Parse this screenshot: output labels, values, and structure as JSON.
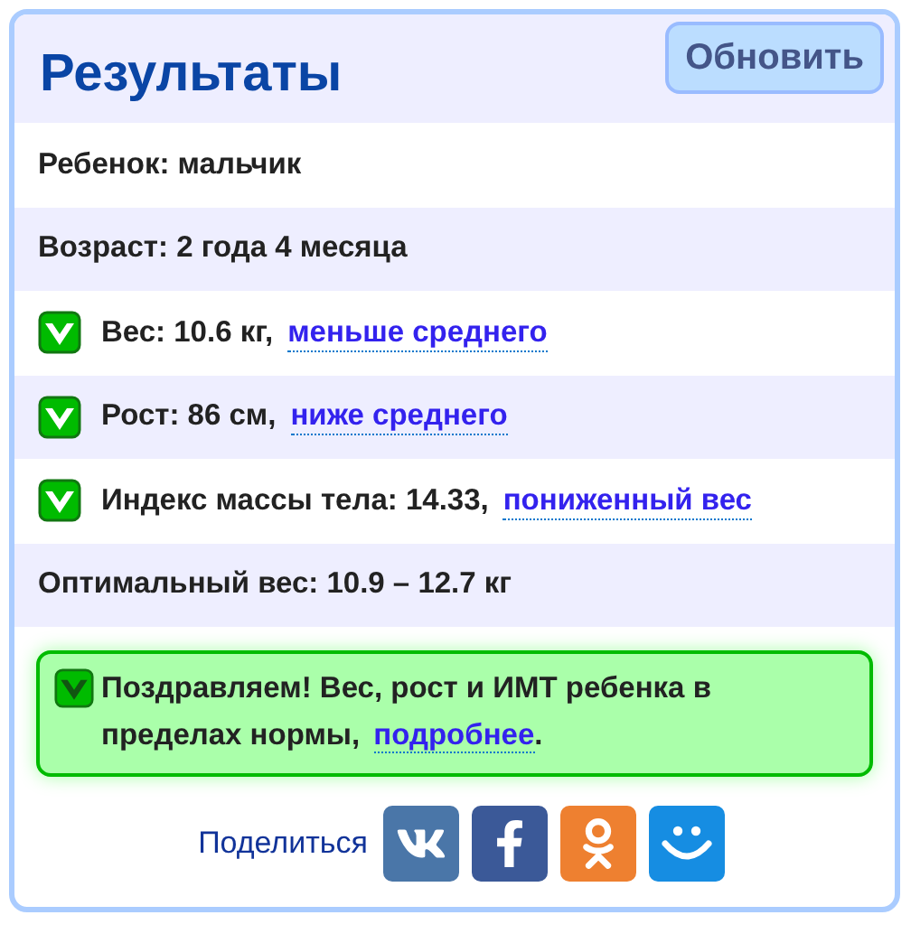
{
  "title": "Результаты",
  "refresh_button": "Обновить",
  "rows": [
    {
      "kind": "text",
      "label": "Ребенок: мальчик"
    },
    {
      "kind": "text",
      "label": "Возраст: 2 года 4 месяца"
    },
    {
      "kind": "check",
      "checked": true,
      "label": "Вес: 10.6 кг,",
      "link": "меньше среднего"
    },
    {
      "kind": "check",
      "checked": true,
      "label": "Рост: 86 см,",
      "link": "ниже среднего"
    },
    {
      "kind": "check",
      "checked": true,
      "label": "Индекс массы тела: 14.33,",
      "link": "пониженный вес"
    },
    {
      "kind": "text",
      "label": "Оптимальный вес: 10.9 – 12.7 кг"
    }
  ],
  "result": {
    "checked": true,
    "text": "Поздравляем! Вес, рост и ИМТ ребенка в пределах нормы,",
    "link": "подробнее",
    "end": "."
  },
  "share": {
    "label": "Поделиться",
    "buttons": [
      {
        "kind": "vk"
      },
      {
        "kind": "fb"
      },
      {
        "kind": "ok"
      },
      {
        "kind": "mail"
      }
    ]
  }
}
